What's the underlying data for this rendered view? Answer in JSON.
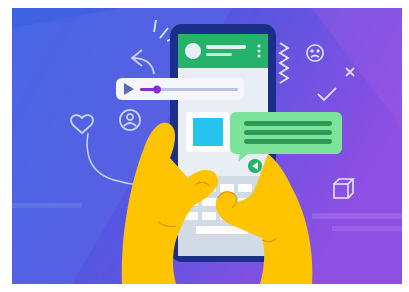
{
  "illustration": {
    "subject": "hands-holding-phone-messaging-app",
    "icons": [
      "heart-icon",
      "user-icon",
      "share-icon",
      "smiley-icon",
      "check-icon",
      "close-icon",
      "cube-icon",
      "send-icon",
      "squiggle-icon"
    ]
  },
  "colors": {
    "background_left": "#3f5fe0",
    "background_right": "#8a4fe0",
    "phone_body": "#1b2f8a",
    "phone_screen": "#e9eef5",
    "app_header": "#25b36b",
    "message_bubble": "#7ee39a",
    "message_lines": "#2f9a55",
    "image_tile": "#27c3ef",
    "hands": "#ffc400",
    "audio_dot": "#8b2bd6"
  }
}
